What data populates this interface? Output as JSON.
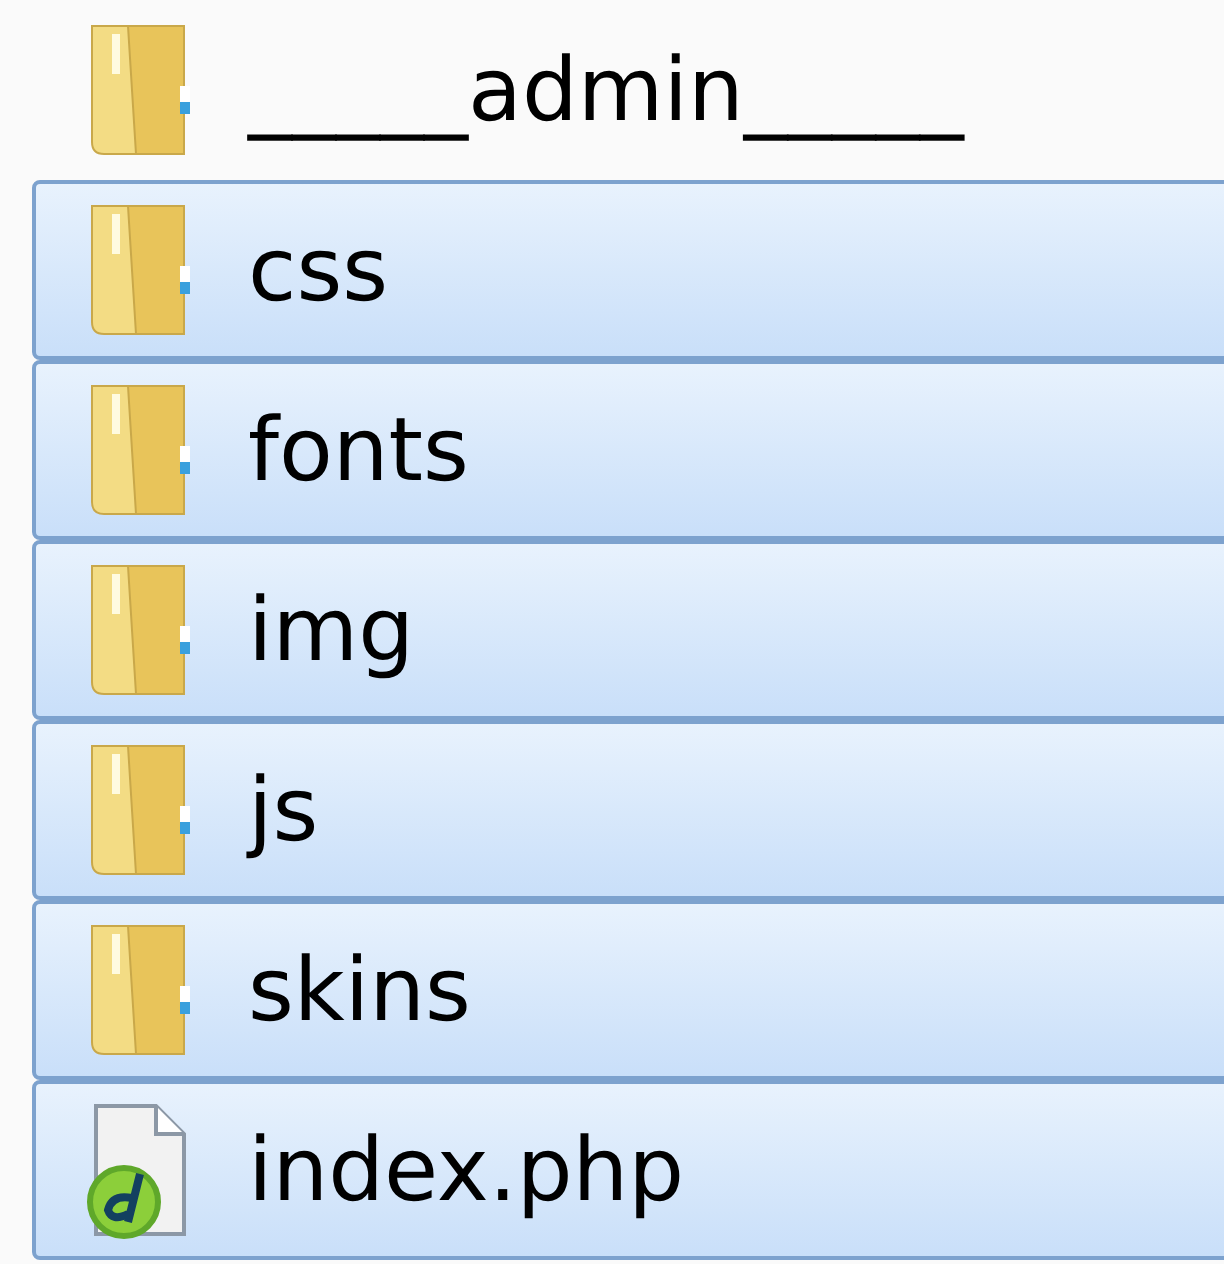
{
  "files": [
    {
      "name": "_____admin_____",
      "kind": "folder",
      "selected": false
    },
    {
      "name": "css",
      "kind": "folder",
      "selected": true
    },
    {
      "name": "fonts",
      "kind": "folder",
      "selected": true
    },
    {
      "name": "img",
      "kind": "folder",
      "selected": true
    },
    {
      "name": "js",
      "kind": "folder",
      "selected": true
    },
    {
      "name": "skins",
      "kind": "folder",
      "selected": true
    },
    {
      "name": "index.php",
      "kind": "php",
      "selected": true
    }
  ]
}
